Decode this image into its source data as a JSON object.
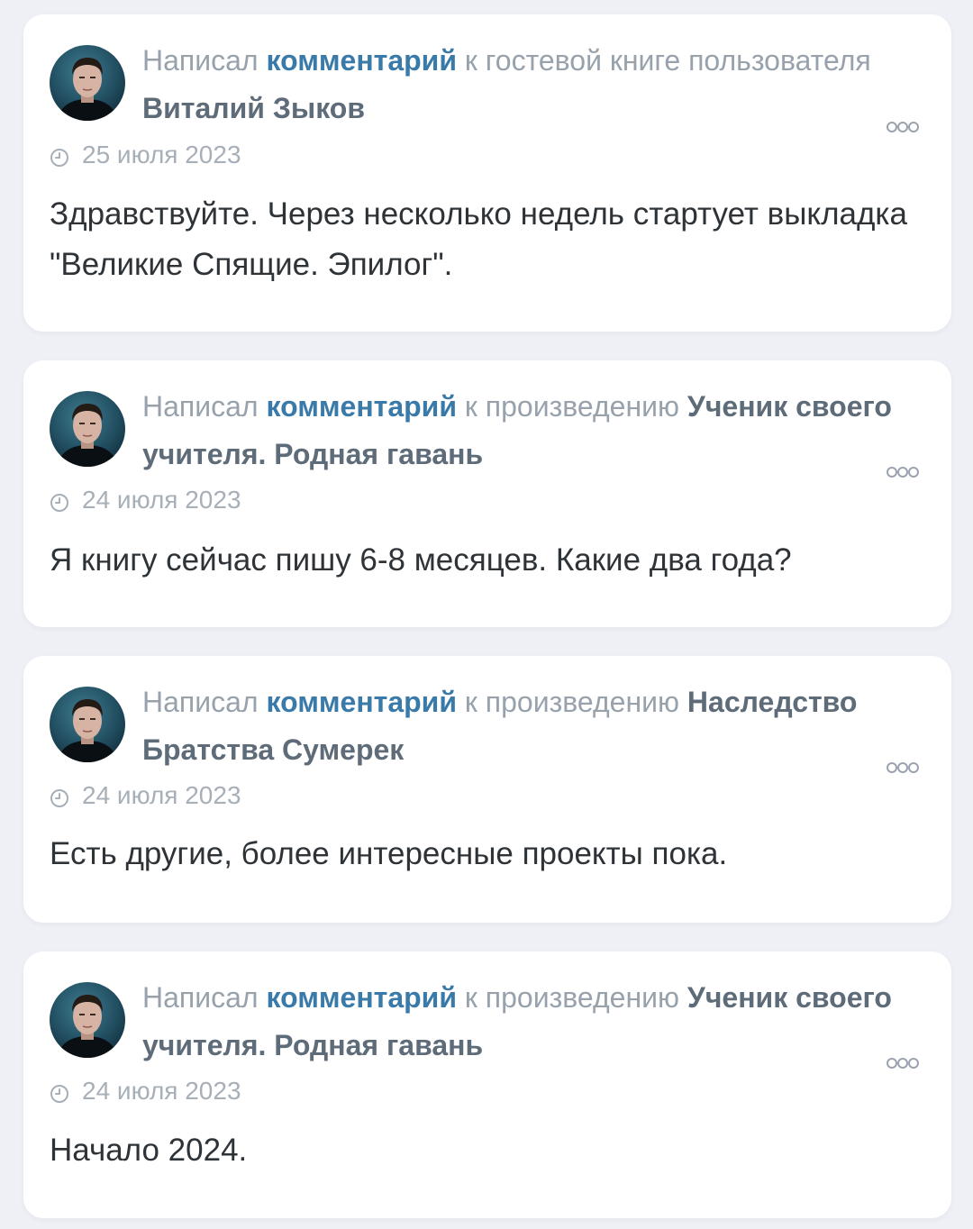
{
  "feed": {
    "items": [
      {
        "prefix": "Написал",
        "link": "комментарий",
        "middle": "к гостевой книге пользователя",
        "target": "Виталий Зыков",
        "date": "25 июля 2023",
        "text": "Здравствуйте. Через несколько недель стартует выкладка \"Великие Спящие. Эпилог\"."
      },
      {
        "prefix": "Написал",
        "link": "комментарий",
        "middle": "к произведению",
        "target": "Ученик своего учителя. Родная гавань",
        "date": "24 июля 2023",
        "text": "Я книгу сейчас пишу 6-8 месяцев. Какие два года?"
      },
      {
        "prefix": "Написал",
        "link": "комментарий",
        "middle": "к произведению",
        "target": "Наследство Братства Сумерек",
        "date": "24 июля 2023",
        "text": "Есть другие, более интересные проекты пока."
      },
      {
        "prefix": "Написал",
        "link": "комментарий",
        "middle": "к произведению",
        "target": "Ученик своего учителя. Родная гавань",
        "date": "24 июля 2023",
        "text": "Начало 2024."
      }
    ]
  }
}
